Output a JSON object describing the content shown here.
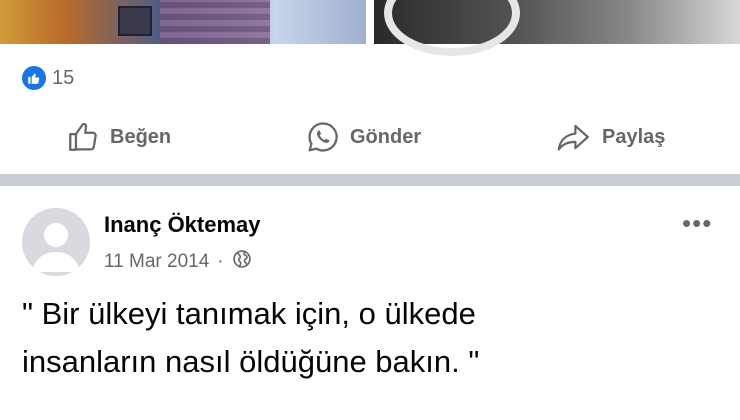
{
  "reactions": {
    "icon": "like-icon",
    "count": "15",
    "accent": "#1b74e4"
  },
  "actions": {
    "like_label": "Beğen",
    "send_label": "Gönder",
    "share_label": "Paylaş"
  },
  "post": {
    "author": "Inanç Öktemay",
    "date": "11 Mar 2014",
    "separator": "·",
    "privacy_icon": "globe-icon",
    "more_icon": "more-options-icon",
    "text_line1": "\" Bir ülkeyi tanımak için, o ülkede",
    "text_line2": "insanların nasıl öldüğüne bakın. \""
  },
  "colors": {
    "secondary_text": "#65676b",
    "divider": "#c9ccd1"
  }
}
